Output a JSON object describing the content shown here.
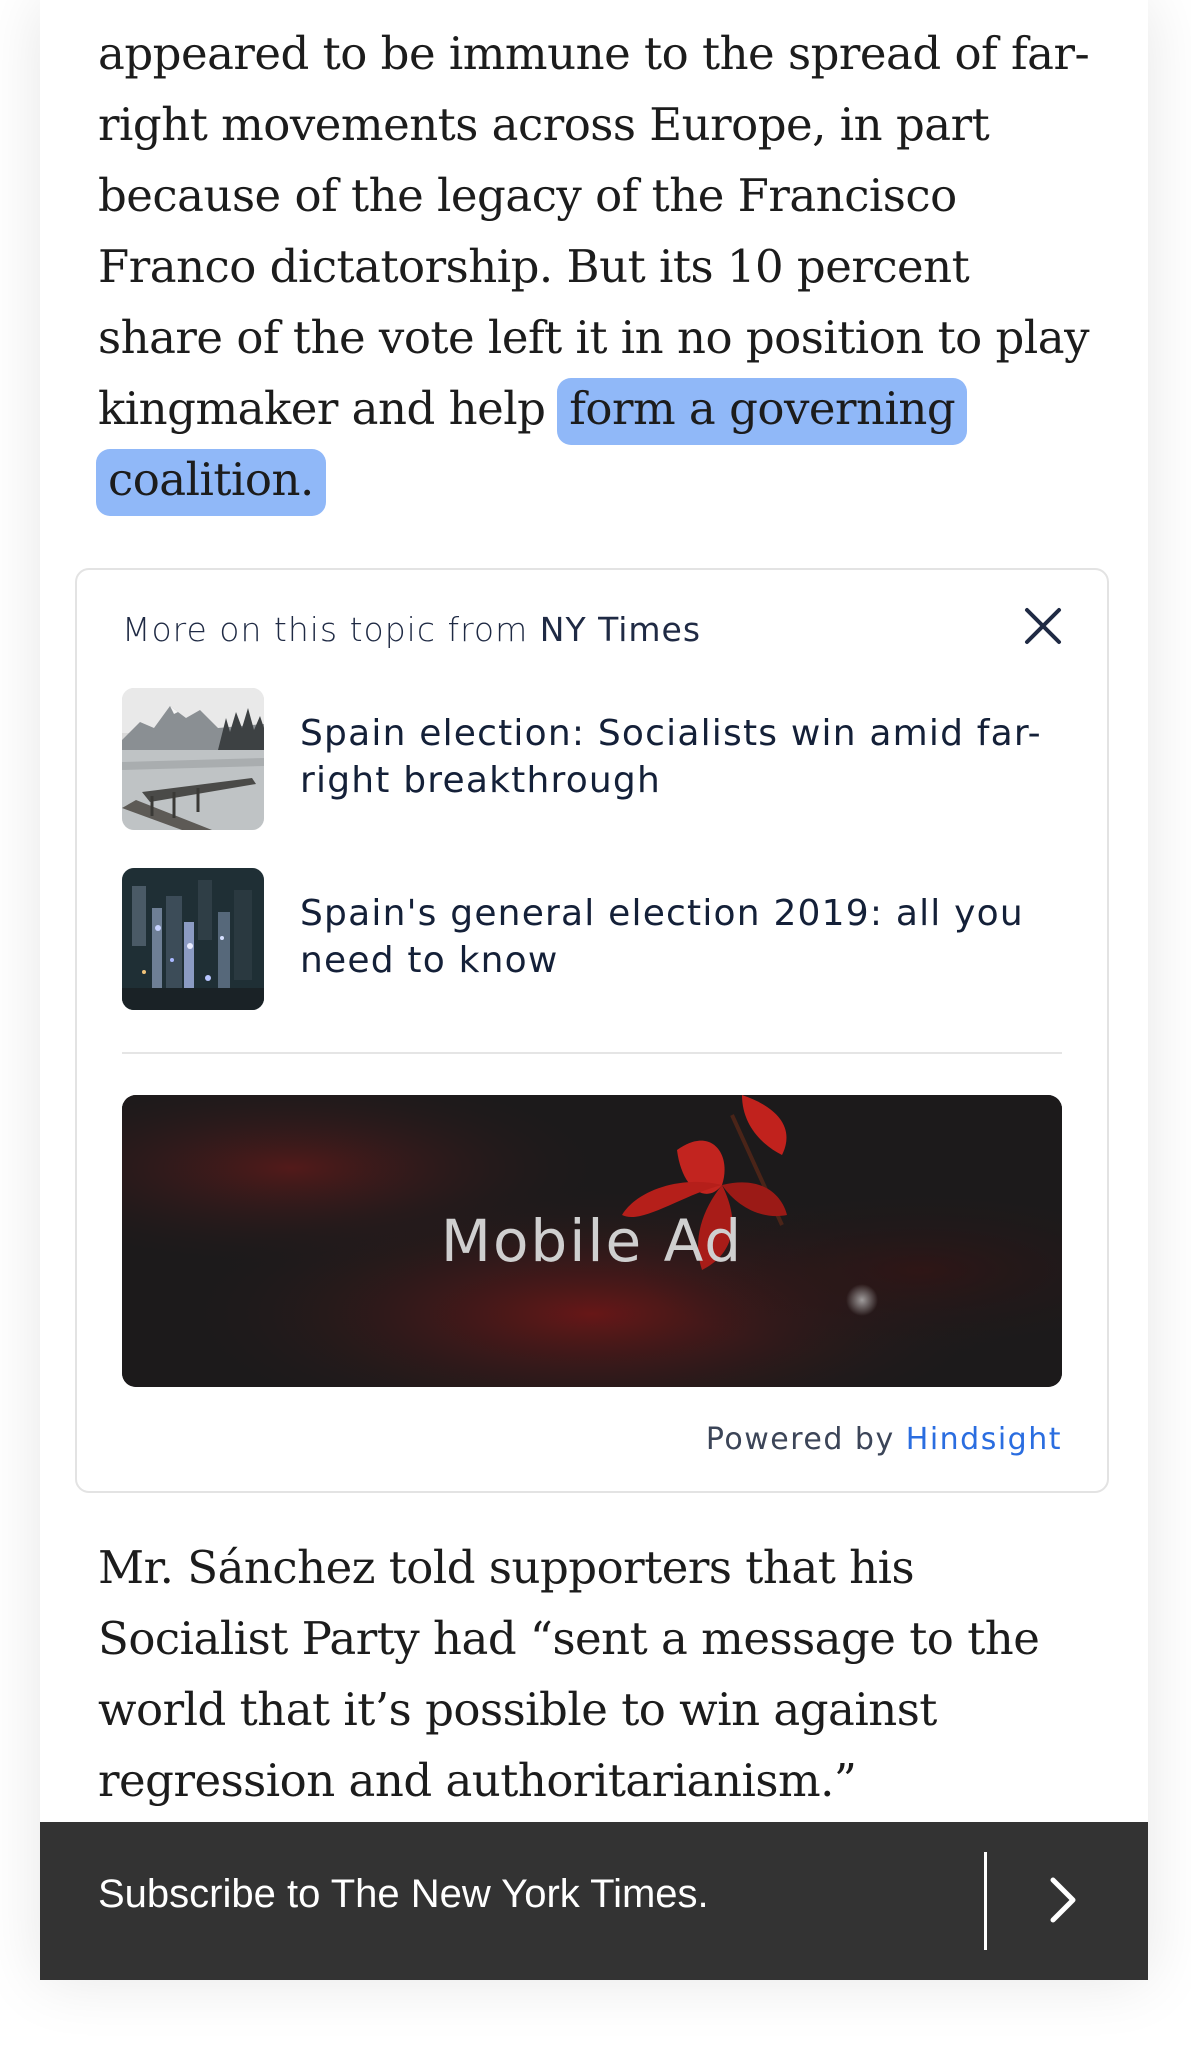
{
  "article": {
    "top_text": "appeared to be immune to the spread of far-right movements across Europe, in part because of the legacy of the Francisco Franco dictatorship. But its 10 percent share of the vote left it in no position to play kingmaker and help ",
    "highlighted_text": "form a governing coalition.",
    "bottom_text": "Mr. Sánchez told supporters that his Socialist Party had “sent a message to the world that it’s possible to win against regression and authoritarianism.”"
  },
  "related_card": {
    "header_prefix": "More on this topic from ",
    "header_source": "NY Times",
    "close_icon": "close-icon",
    "items": [
      {
        "title": "Spain election: Socialists win amid far-right breakthrough",
        "thumbnail": "lake-mountain-photo"
      },
      {
        "title": "Spain's general election 2019: all you need to know",
        "thumbnail": "night-city-aerial-photo"
      }
    ],
    "ad_label": "Mobile Ad",
    "powered_prefix": "Powered by ",
    "powered_brand": "Hindsight"
  },
  "subscribe_bar": {
    "label": "Subscribe to The New York Times.",
    "arrow_icon": "chevron-right-icon"
  },
  "colors": {
    "highlight": "#90b8f8",
    "link": "#2a6de0",
    "subscribe_bg": "#333333"
  }
}
